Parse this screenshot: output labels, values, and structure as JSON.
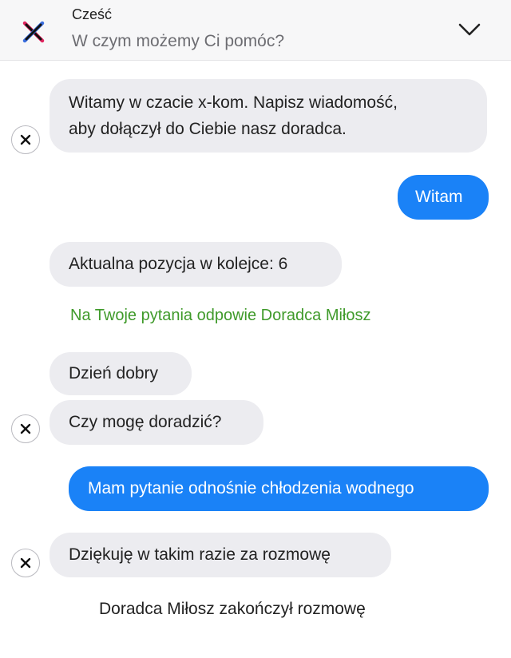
{
  "header": {
    "title": "Cześć",
    "subtitle": "W czym możemy Ci pomóc?",
    "logo_icon": "x-kom-logo",
    "collapse_icon": "chevron-down-icon"
  },
  "colors": {
    "incoming_bubble": "#ececf0",
    "outgoing_bubble": "#1a82f7",
    "system_green": "#3f9a2a",
    "header_bg": "#f7f7f8"
  },
  "messages": [
    {
      "type": "incoming",
      "lines": [
        "Witamy w czacie x-kom. Napisz wiadomość,",
        "aby dołączył do Ciebie nasz doradca."
      ],
      "avatar": true
    },
    {
      "type": "outgoing",
      "text": "Witam"
    },
    {
      "type": "incoming",
      "text": "Aktualna pozycja w kolejce: 6",
      "avatar": false
    },
    {
      "type": "system",
      "text": "Na Twoje pytania odpowie Doradca Miłosz"
    },
    {
      "type": "incoming",
      "text": "Dzień dobry",
      "avatar": false
    },
    {
      "type": "incoming",
      "text": "Czy mogę doradzić?",
      "avatar": true
    },
    {
      "type": "outgoing",
      "text": "Mam pytanie odnośnie chłodzenia wodnego"
    },
    {
      "type": "incoming",
      "text": "Dziękuję w takim razie za rozmowę",
      "avatar": true
    },
    {
      "type": "system",
      "text": "Doradca Miłosz zakończył rozmowę"
    }
  ]
}
